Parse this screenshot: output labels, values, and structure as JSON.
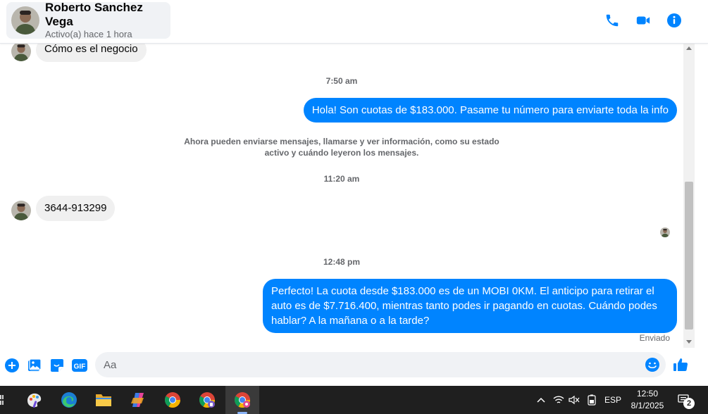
{
  "contact": {
    "name": "Roberto Sanchez Vega",
    "status": "Activo(a) hace 1 hora"
  },
  "header_icons": [
    "phone-icon",
    "video-call-icon",
    "info-icon"
  ],
  "messages": {
    "m1": "Cómo es el negocio",
    "t1": "7:50 am",
    "m2": "Hola! Son cuotas de $183.000. Pasame tu número para enviarte toda la info",
    "notice": "Ahora pueden enviarse mensajes, llamarse y ver información, como su estado activo y cuándo leyeron los mensajes.",
    "t2": "11:20 am",
    "m3": "3644-913299",
    "t3": "12:48 pm",
    "m4": "Perfecto! La cuota desde $183.000 es de un MOBI 0KM. El anticipo para retirar el auto es de $7.716.400, mientras tanto podes ir pagando en cuotas. Cuándo podes hablar? A la mañana o a la tarde?",
    "sent_status": "Enviado"
  },
  "composer": {
    "placeholder": "Aa",
    "value": "",
    "icons": [
      "plus-icon",
      "photo-icon",
      "sticker-icon",
      "gif-icon",
      "emoji-icon",
      "like-icon"
    ],
    "gif_label": "GIF"
  },
  "taskbar": {
    "apps": [
      "paint-icon",
      "edge-icon",
      "file-explorer-icon",
      "copilot-icon",
      "chrome-icon",
      "chrome-profile-icon",
      "chrome-active-icon"
    ],
    "language": "ESP",
    "time": "12:50",
    "date": "8/1/2025",
    "notifications": "2"
  },
  "colors": {
    "accent": "#0084ff",
    "incoming_bubble": "#f0f0f0",
    "taskbar": "#1f1f1f"
  }
}
